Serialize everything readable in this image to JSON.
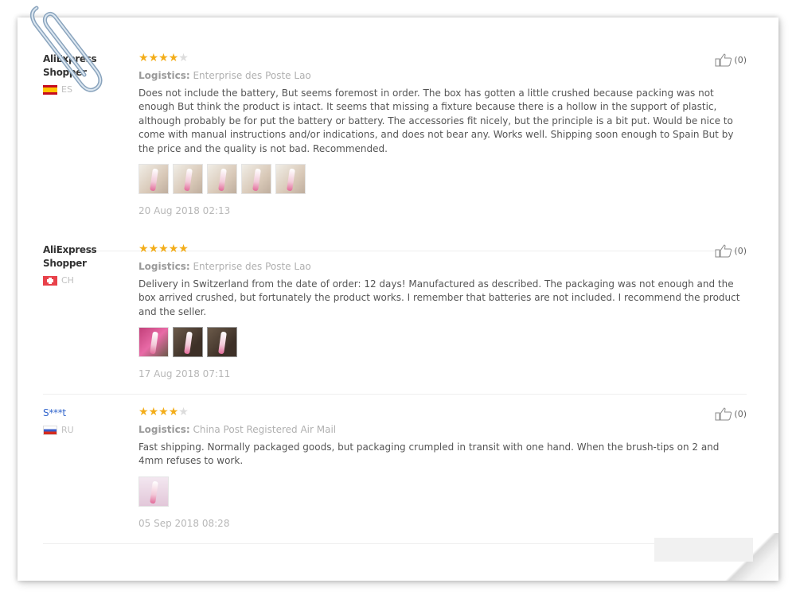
{
  "reviews": [
    {
      "user_name": "AliExpress Shopper",
      "country": "ES",
      "rating": 4,
      "logistics_label": "Logistics:",
      "logistics": "Enterprise des Poste Lao",
      "text": "Does not include the battery, But seems foremost in order. The box has gotten a little crushed because packing was not enough But think the product is intact. It seems that missing a fixture because there is a hollow in the support of plastic, although probably be for put the battery or battery. The accessories fit nicely, but the principle is a bit put. Would be nice to come with manual instructions and/or indications, and does not bear any. Works well. Shipping soon enough to Spain But by the price and the quality is not bad. Recommended.",
      "photos": 5,
      "date": "20 Aug 2018 02:13",
      "helpful_count": "(0)"
    },
    {
      "user_name": "AliExpress Shopper",
      "country": "CH",
      "rating": 5,
      "logistics_label": "Logistics:",
      "logistics": "Enterprise des Poste Lao",
      "text": "Delivery in Switzerland from the date of order: 12 days! Manufactured as described. The packaging was not enough and the box arrived crushed, but fortunately the product works. I remember that batteries are not included. I recommend the product and the seller.",
      "photos": 3,
      "date": "17 Aug 2018 07:11",
      "helpful_count": "(0)"
    },
    {
      "user_name": "S***t",
      "country": "RU",
      "rating": 4,
      "logistics_label": "Logistics:",
      "logistics": "China Post Registered Air Mail",
      "text": "Fast shipping. Normally packaged goods, but packaging crumpled in transit with one hand. When the brush-tips on 2 and 4mm refuses to work.",
      "photos": 1,
      "date": "05 Sep 2018 08:28",
      "helpful_count": "(0)"
    }
  ],
  "colors": {
    "star": "#f3ad19",
    "star_off": "#dcdcdc",
    "anon_user": "#3366cc"
  },
  "icons": {
    "helpful": "thumbs-up-icon",
    "paperclip": "paperclip-icon"
  }
}
